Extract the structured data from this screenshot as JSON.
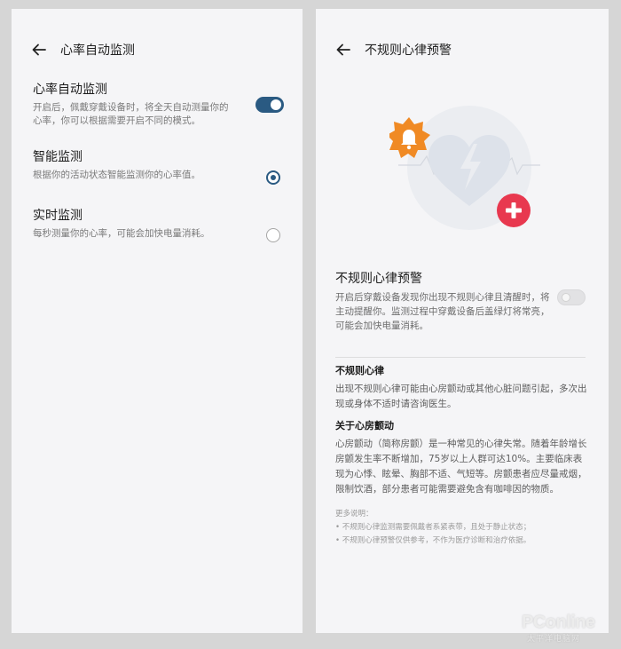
{
  "left_screen": {
    "title": "心率自动监测",
    "auto_monitor": {
      "title": "心率自动监测",
      "desc": "开启后，佩戴穿戴设备时，将全天自动测量你的心率，你可以根据需要开启不同的模式。",
      "enabled": true
    },
    "smart_monitor": {
      "title": "智能监测",
      "desc": "根据你的活动状态智能监测你的心率值。",
      "selected": true
    },
    "realtime_monitor": {
      "title": "实时监测",
      "desc": "每秒测量你的心率，可能会加快电量消耗。",
      "selected": false
    }
  },
  "right_screen": {
    "title": "不规则心律预警",
    "alert": {
      "title": "不规则心律预警",
      "desc": "开启后穿戴设备发现你出现不规则心律且清醒时，将主动提醒你。监测过程中穿戴设备后盖绿灯将常亮，可能会加快电量消耗。",
      "enabled": false
    },
    "irregular": {
      "title": "不规则心律",
      "body": "出现不规则心律可能由心房颤动或其他心脏问题引起，多次出现或身体不适时请咨询医生。"
    },
    "afib": {
      "title": "关于心房颤动",
      "body": "心房颤动（简称房颤）是一种常见的心律失常。随着年龄增长房颤发生率不断增加，75岁以上人群可达10%。主要临床表现为心悸、眩晕、胸部不适、气短等。房颤患者应尽量戒烟，限制饮酒，部分患者可能需要避免含有咖啡因的物质。"
    },
    "more": {
      "label": "更多说明：",
      "items": [
        "• 不规则心律监测需要佩戴者系紧表带，且处于静止状态；",
        "• 不规则心律预警仅供参考，不作为医疗诊断和治疗依据。"
      ]
    }
  },
  "watermark": {
    "brand": "PConline",
    "sub": "太平洋电脑网"
  },
  "colors": {
    "accent": "#2a5a82",
    "alert_orange": "#f08a24",
    "plus_red": "#e8384f",
    "heart": "#dde2ea"
  },
  "icons": {
    "back": "arrow-left-icon",
    "bell": "bell-badge-icon",
    "heart": "heart-lightning-icon",
    "plus": "plus-circle-icon"
  }
}
